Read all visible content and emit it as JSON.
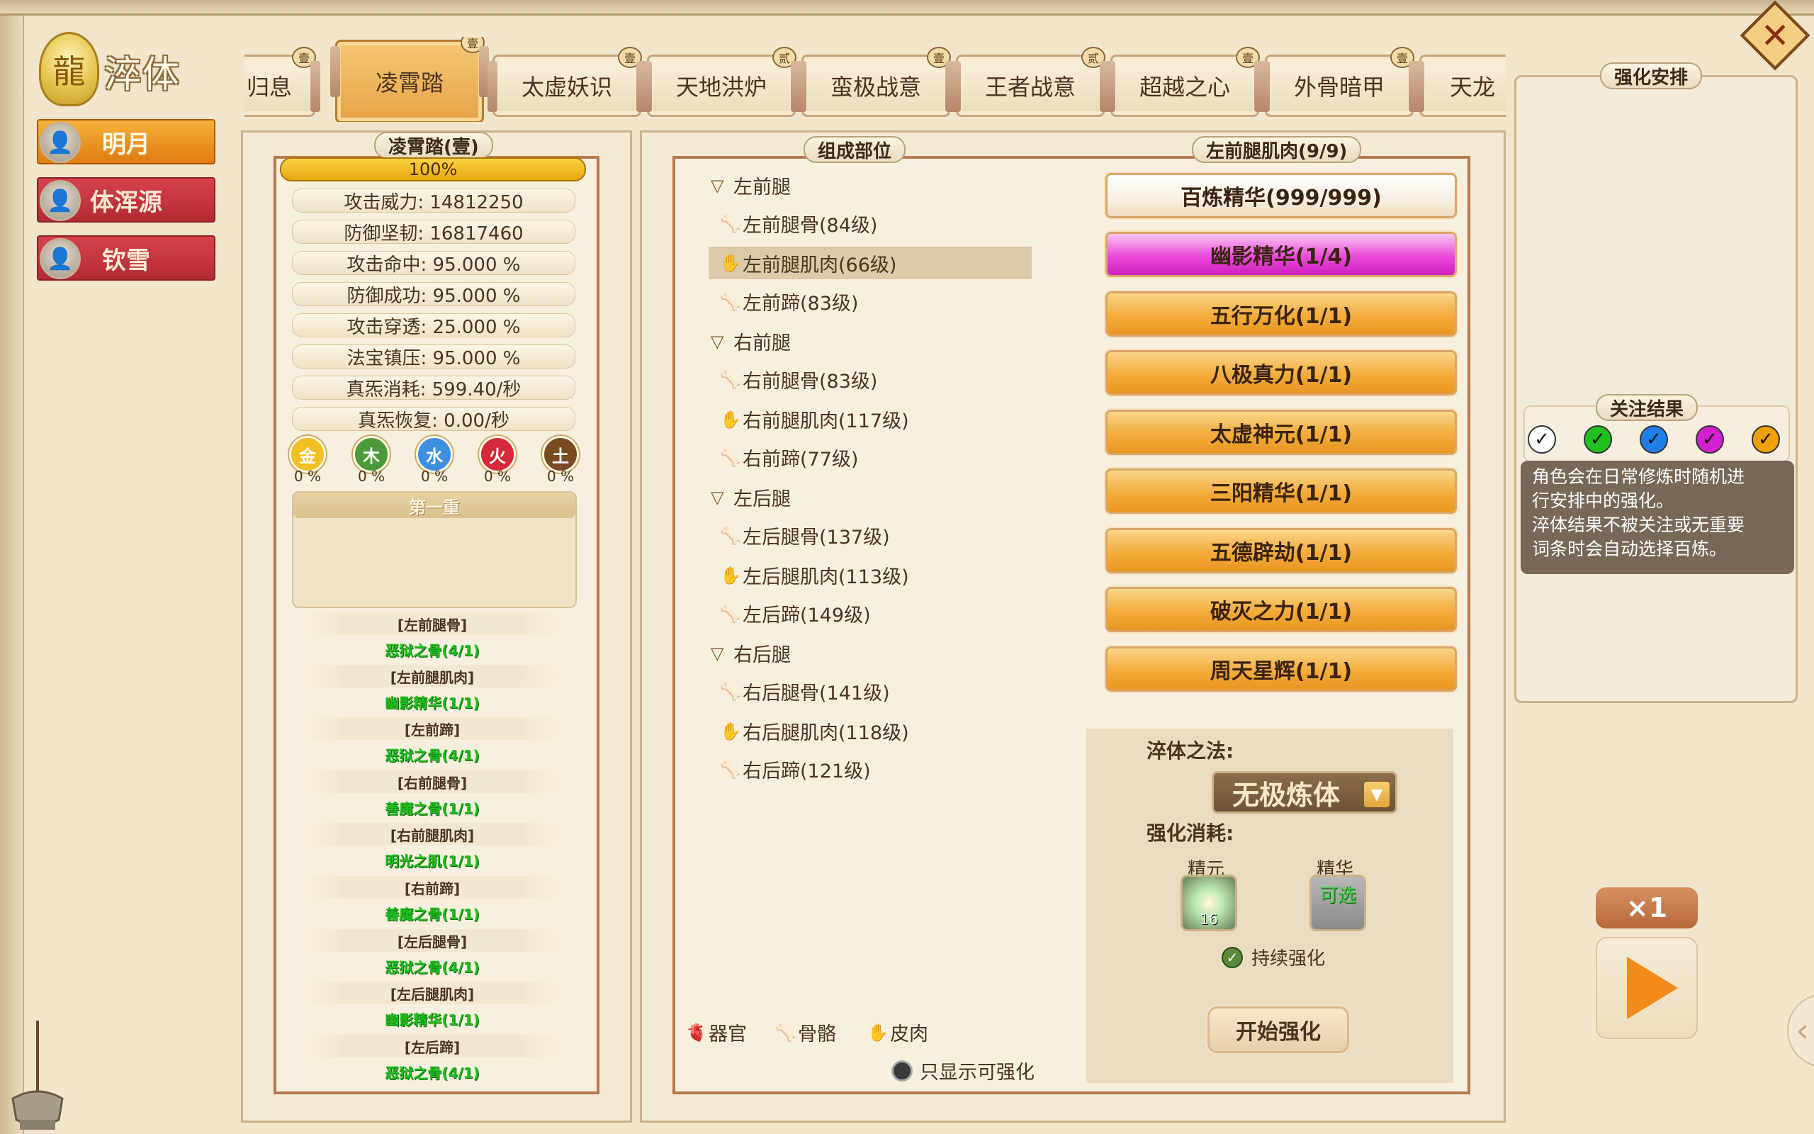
{
  "title": "淬体",
  "characters": [
    {
      "name": "明月",
      "active": true
    },
    {
      "name": "体浑源",
      "active": false
    },
    {
      "name": "钦雪",
      "active": false
    }
  ],
  "tabs": [
    {
      "label": "归息"
    },
    {
      "label": "凌霄踏",
      "active": true
    },
    {
      "label": "太虚妖识"
    },
    {
      "label": "天地洪炉"
    },
    {
      "label": "蛮极战意"
    },
    {
      "label": "王者战意"
    },
    {
      "label": "超越之心"
    },
    {
      "label": "外骨暗甲"
    },
    {
      "label": "天龙"
    }
  ],
  "left_panel": {
    "header": "凌霄踏(壹)",
    "progress_text": "100%",
    "progress": 1.0,
    "stats": [
      "攻击威力: 14812250",
      "防御坚韧: 16817460",
      "攻击命中: 95.000 %",
      "防御成功: 95.000 %",
      "攻击穿透: 25.000 %",
      "法宝镇压: 95.000 %",
      "真炁消耗: 599.40/秒",
      "真炁恢复: 0.00/秒"
    ],
    "elements": [
      {
        "label": "金",
        "pct": "0 %",
        "color": "#f2c024"
      },
      {
        "label": "木",
        "pct": "0 %",
        "color": "#4a9a3a"
      },
      {
        "label": "水",
        "pct": "0 %",
        "color": "#3f8fe0"
      },
      {
        "label": "火",
        "pct": "0 %",
        "color": "#d62a3a"
      },
      {
        "label": "土",
        "pct": "0 %",
        "color": "#7a4a20"
      }
    ],
    "tier_title": "第一重",
    "requirements": [
      {
        "part": "[左前腿骨]",
        "need": "恶狱之骨(4/1)"
      },
      {
        "part": "[左前腿肌肉]",
        "need": "幽影精华(1/1)"
      },
      {
        "part": "[左前蹄]",
        "need": "恶狱之骨(4/1)"
      },
      {
        "part": "[右前腿骨]",
        "need": "善魔之骨(1/1)"
      },
      {
        "part": "[右前腿肌肉]",
        "need": "明光之肌(1/1)"
      },
      {
        "part": "[右前蹄]",
        "need": "善魔之骨(1/1)"
      },
      {
        "part": "[左后腿骨]",
        "need": "恶狱之骨(4/1)"
      },
      {
        "part": "[左后腿肌肉]",
        "need": "幽影精华(1/1)"
      },
      {
        "part": "[左后蹄]",
        "need": "恶狱之骨(4/1)"
      }
    ]
  },
  "parts_panel": {
    "header": "组成部位",
    "tree": [
      {
        "label": "左前腿",
        "type": "group"
      },
      {
        "label": "左前腿骨(84级)",
        "type": "bone"
      },
      {
        "label": "左前腿肌肉(66级)",
        "type": "skin",
        "selected": true
      },
      {
        "label": "左前蹄(83级)",
        "type": "bone"
      },
      {
        "label": "右前腿",
        "type": "group"
      },
      {
        "label": "右前腿骨(83级)",
        "type": "bone"
      },
      {
        "label": "右前腿肌肉(117级)",
        "type": "skin"
      },
      {
        "label": "右前蹄(77级)",
        "type": "bone"
      },
      {
        "label": "左后腿",
        "type": "group"
      },
      {
        "label": "左后腿骨(137级)",
        "type": "bone"
      },
      {
        "label": "左后腿肌肉(113级)",
        "type": "skin"
      },
      {
        "label": "左后蹄(149级)",
        "type": "bone"
      },
      {
        "label": "右后腿",
        "type": "group"
      },
      {
        "label": "右后腿骨(141级)",
        "type": "bone"
      },
      {
        "label": "右后腿肌肉(118级)",
        "type": "skin"
      },
      {
        "label": "右后蹄(121级)",
        "type": "bone"
      }
    ],
    "legend": {
      "organ": "器官",
      "bone": "骨骼",
      "skin": "皮肉"
    },
    "filter_label": "只显示可强化"
  },
  "essence_panel": {
    "header": "左前腿肌肉(9/9)",
    "essences": [
      {
        "label": "百炼精华(999/999)",
        "style": "white"
      },
      {
        "label": "幽影精华(1/4)",
        "style": "magenta"
      },
      {
        "label": "五行万化(1/1)",
        "style": "gold"
      },
      {
        "label": "八极真力(1/1)",
        "style": "gold"
      },
      {
        "label": "太虚神元(1/1)",
        "style": "gold"
      },
      {
        "label": "三阳精华(1/1)",
        "style": "gold"
      },
      {
        "label": "五德辟劫(1/1)",
        "style": "gold"
      },
      {
        "label": "破灭之力(1/1)",
        "style": "gold"
      },
      {
        "label": "周天星辉(1/1)",
        "style": "gold"
      }
    ],
    "method_label": "淬体之法:",
    "method_value": "无极炼体",
    "cost_label": "强化消耗:",
    "slot_jingyuan_label": "精元",
    "slot_jingyuan_count": "16",
    "slot_jinghua_label": "精华",
    "slot_jinghua_text": "可选",
    "continuous_label": "持续强化",
    "start_label": "开始强化"
  },
  "right_panel": {
    "header": "强化安排",
    "focus_header": "关注结果",
    "focus_colors": [
      "#ffffff",
      "#20c020",
      "#1f7fe8",
      "#d020d0",
      "#f0a000"
    ],
    "info_text": "角色会在日常修炼时随机进行安排中的强化。淬体结果不被关注或无重要词条时会自动选择百炼。",
    "info_lines": [
      "角色会在日常修炼时随机进",
      "行安排中的强化。",
      "淬体结果不被关注或无重要",
      "词条时会自动选择百炼。"
    ]
  },
  "controls": {
    "speed": "×1"
  }
}
